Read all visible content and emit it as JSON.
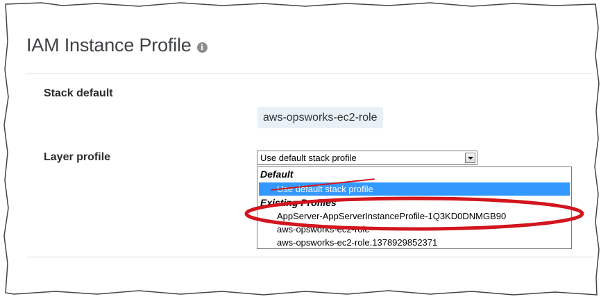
{
  "section": {
    "title": "IAM Instance Profile",
    "info_icon": "info-icon"
  },
  "stack_default": {
    "label": "Stack default",
    "value": "aws-opsworks-ec2-role"
  },
  "layer_profile": {
    "label": "Layer profile",
    "selected_value": "Use default stack profile",
    "dropdown": {
      "group_default": "Default",
      "option_default": "Use default stack profile",
      "group_existing": "Existing Profiles",
      "options": [
        "AppServer-AppServerInstanceProfile-1Q3KD0DNMGB90",
        "aws-opsworks-ec2-role",
        "aws-opsworks-ec2-role.1378929852371"
      ]
    }
  },
  "colors": {
    "selection": "#3399ff",
    "annotation": "#d2151e",
    "pill_bg": "#e8f1f8"
  }
}
